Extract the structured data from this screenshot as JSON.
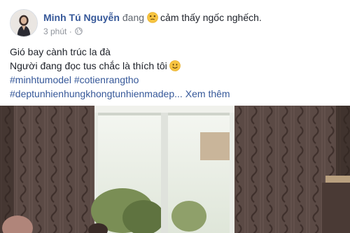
{
  "post": {
    "author": "Minh Tú Nguyễn",
    "status_word": "đang",
    "feeling_emoji": "dizzy-face-icon",
    "feeling": "cảm thấy ngốc nghếch.",
    "timestamp": "3 phút",
    "separator": "·",
    "audience_icon": "globe-icon",
    "lines": [
      "Gió bay cành trúc la đà",
      "Người đang đọc tus chắc là thích tôi"
    ],
    "smile_emoji": "smiling-face-icon",
    "hashtags_line1": [
      "#minhtumodel",
      "#cotienrangtho"
    ],
    "hashtag_line2": "#deptunhienhungkhongtunhienmadep...",
    "see_more": "Xem thêm",
    "photo_description_icon": "post-photo"
  },
  "colors": {
    "link": "#365899",
    "meta": "#90949c",
    "text": "#1d2129"
  }
}
